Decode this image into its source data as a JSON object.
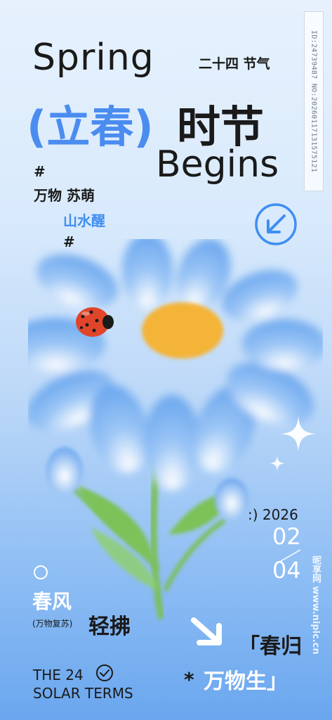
{
  "header": {
    "spring": "Spring",
    "jieqi": "二十四  节气",
    "lichun": "(立春)",
    "shijie": "时节",
    "begins": "Begins"
  },
  "tags": {
    "hash_top": "#",
    "wanwu_sumeng": "万物  苏萌",
    "shanshui_xing": "山水醒",
    "hash_bottom": "#"
  },
  "date": {
    "year": ":) 2026",
    "month": "02",
    "day": "04"
  },
  "bottom_left": {
    "chunfeng": "春风",
    "wanwu_fusu": "(万物复苏)",
    "qingfu": "轻拂",
    "the24": "THE 24",
    "solar_terms": "SOLAR TERMS"
  },
  "bottom_right": {
    "chungui": "「春归",
    "star": "*",
    "wanwusheng": "万物生」"
  },
  "watermark": {
    "id": "ID:24739487 NO:20260117131575121",
    "site": "昵享网 www.nipic.cn"
  },
  "colors": {
    "accent_blue": "#4a8cf0",
    "petal_blue": "#7fb3f2",
    "center_yellow": "#f3b23a",
    "stem_green": "#6aa84f",
    "ladybug_red": "#d9442a"
  },
  "icons": [
    "arrow-down-left-circle-icon",
    "check-circle-icon",
    "arrow-down-right-icon",
    "sparkle-icon",
    "ladybug-icon"
  ]
}
